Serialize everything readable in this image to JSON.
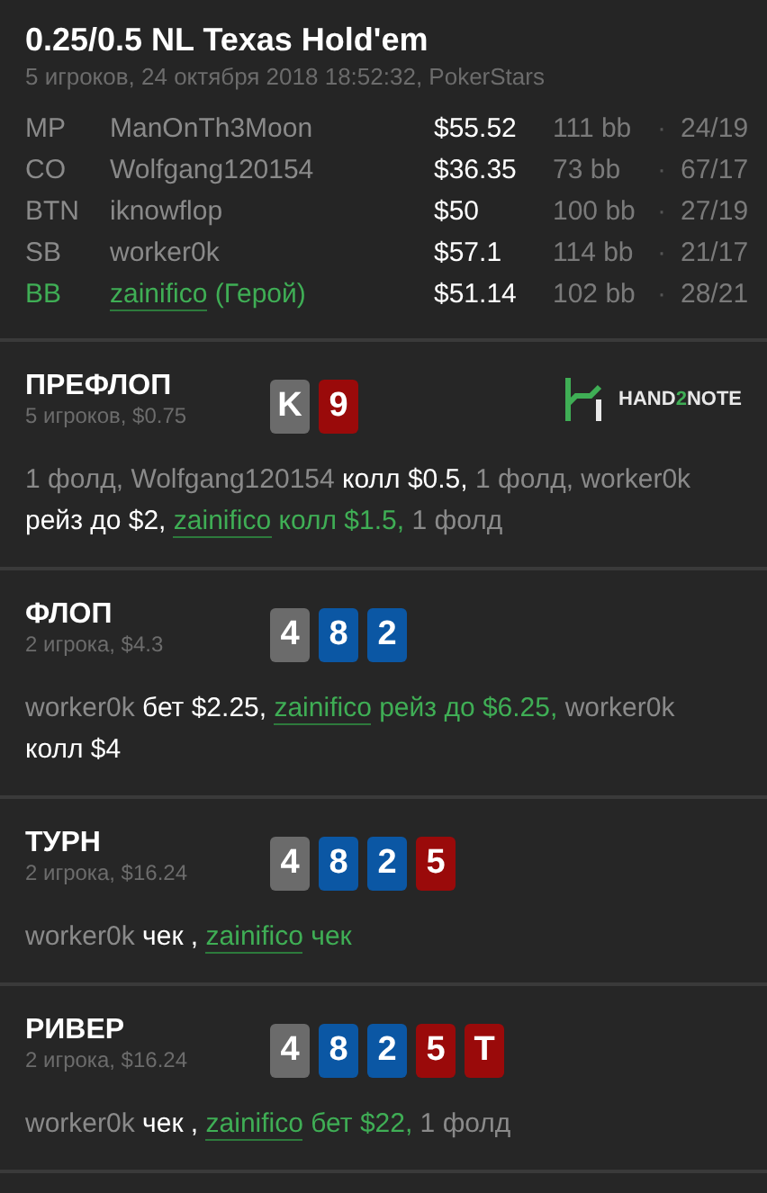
{
  "header": {
    "title": "0.25/0.5 NL Texas Hold'em",
    "subtitle": "5 игроков, 24 октября 2018 18:52:32, PokerStars"
  },
  "players": [
    {
      "position": "MP",
      "name": "ManOnTh3Moon",
      "hero": false,
      "stack": "$55.52",
      "bb": "111 bb",
      "separator": "·",
      "stats": "24/19"
    },
    {
      "position": "CO",
      "name": "Wolfgang120154",
      "hero": false,
      "stack": "$36.35",
      "bb": "73 bb",
      "separator": "·",
      "stats": "67/17"
    },
    {
      "position": "BTN",
      "name": "iknowflop",
      "hero": false,
      "stack": "$50",
      "bb": "100 bb",
      "separator": "·",
      "stats": "27/19"
    },
    {
      "position": "SB",
      "name": "worker0k",
      "hero": false,
      "stack": "$57.1",
      "bb": "114 bb",
      "separator": "·",
      "stats": "21/17"
    },
    {
      "position": "BB",
      "name": "zainifico",
      "hero": true,
      "hero_label": "(Герой)",
      "stack": "$51.14",
      "bb": "102 bb",
      "separator": "·",
      "stats": "28/21"
    }
  ],
  "streets": [
    {
      "name": "ПРЕФЛОП",
      "info": "5 игроков, $0.75",
      "logo": {
        "before": "HAND",
        "accent": "2",
        "after": "NOTE"
      },
      "cards": [
        {
          "rank": "K",
          "color": "#6b6b6b"
        },
        {
          "rank": "9",
          "color": "#9a0a0a"
        }
      ],
      "actions": [
        {
          "kind": "muted",
          "text": "1 фолд, Wolfgang120154 "
        },
        {
          "kind": "bold",
          "text": "колл $0.5,"
        },
        {
          "kind": "muted",
          "text": " 1 фолд, worker0k "
        },
        {
          "kind": "bold",
          "text": "рейз до $2, "
        },
        {
          "kind": "hero-name",
          "text": "zainifico"
        },
        {
          "kind": "hero",
          "text": " колл $1.5,"
        },
        {
          "kind": "muted",
          "text": " 1 фолд"
        }
      ]
    },
    {
      "name": "ФЛОП",
      "info": "2 игрока, $4.3",
      "cards": [
        {
          "rank": "4",
          "color": "#6b6b6b"
        },
        {
          "rank": "8",
          "color": "#0b57a4"
        },
        {
          "rank": "2",
          "color": "#0b57a4"
        }
      ],
      "actions": [
        {
          "kind": "muted",
          "text": "worker0k "
        },
        {
          "kind": "bold",
          "text": "бет $2.25, "
        },
        {
          "kind": "hero-name",
          "text": "zainifico"
        },
        {
          "kind": "hero",
          "text": " рейз до $6.25,"
        },
        {
          "kind": "muted",
          "text": " worker0k "
        },
        {
          "kind": "bold",
          "text": "колл $4"
        }
      ]
    },
    {
      "name": "ТУРН",
      "info": "2 игрока, $16.24",
      "cards": [
        {
          "rank": "4",
          "color": "#6b6b6b"
        },
        {
          "rank": "8",
          "color": "#0b57a4"
        },
        {
          "rank": "2",
          "color": "#0b57a4"
        },
        {
          "rank": "5",
          "color": "#9a0a0a"
        }
      ],
      "actions": [
        {
          "kind": "muted",
          "text": "worker0k "
        },
        {
          "kind": "bold",
          "text": "чек , "
        },
        {
          "kind": "hero-name",
          "text": "zainifico"
        },
        {
          "kind": "hero",
          "text": " чек"
        }
      ]
    },
    {
      "name": "РИВЕР",
      "info": "2 игрока, $16.24",
      "cards": [
        {
          "rank": "4",
          "color": "#6b6b6b"
        },
        {
          "rank": "8",
          "color": "#0b57a4"
        },
        {
          "rank": "2",
          "color": "#0b57a4"
        },
        {
          "rank": "5",
          "color": "#9a0a0a"
        },
        {
          "rank": "T",
          "color": "#9a0a0a"
        }
      ],
      "actions": [
        {
          "kind": "muted",
          "text": "worker0k "
        },
        {
          "kind": "bold",
          "text": "чек , "
        },
        {
          "kind": "hero-name",
          "text": "zainifico"
        },
        {
          "kind": "hero",
          "text": " бет $22,"
        },
        {
          "kind": "muted",
          "text": " 1 фолд"
        }
      ]
    }
  ]
}
